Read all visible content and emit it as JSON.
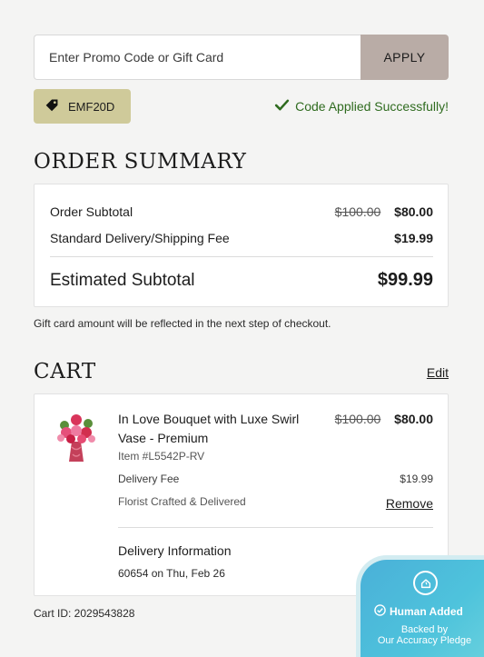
{
  "promo": {
    "placeholder": "Enter Promo Code or Gift Card",
    "apply_label": "APPLY",
    "applied_code": "EMF20D",
    "success_message": "Code Applied Successfully!"
  },
  "order_summary": {
    "heading": "ORDER SUMMARY",
    "rows": [
      {
        "label": "Order Subtotal",
        "original": "$100.00",
        "value": "$80.00"
      },
      {
        "label": "Standard Delivery/Shipping Fee",
        "value": "$19.99"
      }
    ],
    "total_label": "Estimated Subtotal",
    "total_value": "$99.99",
    "gift_note": "Gift card amount will be reflected in the next step of checkout."
  },
  "cart": {
    "heading": "CART",
    "edit_label": "Edit",
    "item": {
      "name": "In Love Bouquet with Luxe Swirl Vase - Premium",
      "original_price": "$100.00",
      "price": "$80.00",
      "sku": "Item #L5542P-RV",
      "delivery_fee_label": "Delivery Fee",
      "delivery_fee": "$19.99",
      "fulfillment": "Florist Crafted & Delivered",
      "remove_label": "Remove"
    },
    "delivery_title": "Delivery Information",
    "delivery_detail": "60654 on Thu, Feb 26",
    "cart_id": "Cart ID: 2029543828"
  },
  "pledge": {
    "title": "Human Added",
    "line1": "Backed by",
    "line2": "Our Accuracy Pledge"
  },
  "colors": {
    "background": "#f4f4f3",
    "apply_button": "#b9aca6",
    "code_chip": "#cfca9a",
    "success_green": "#2f6b1f",
    "pledge_blue": "#4ec3dc"
  }
}
